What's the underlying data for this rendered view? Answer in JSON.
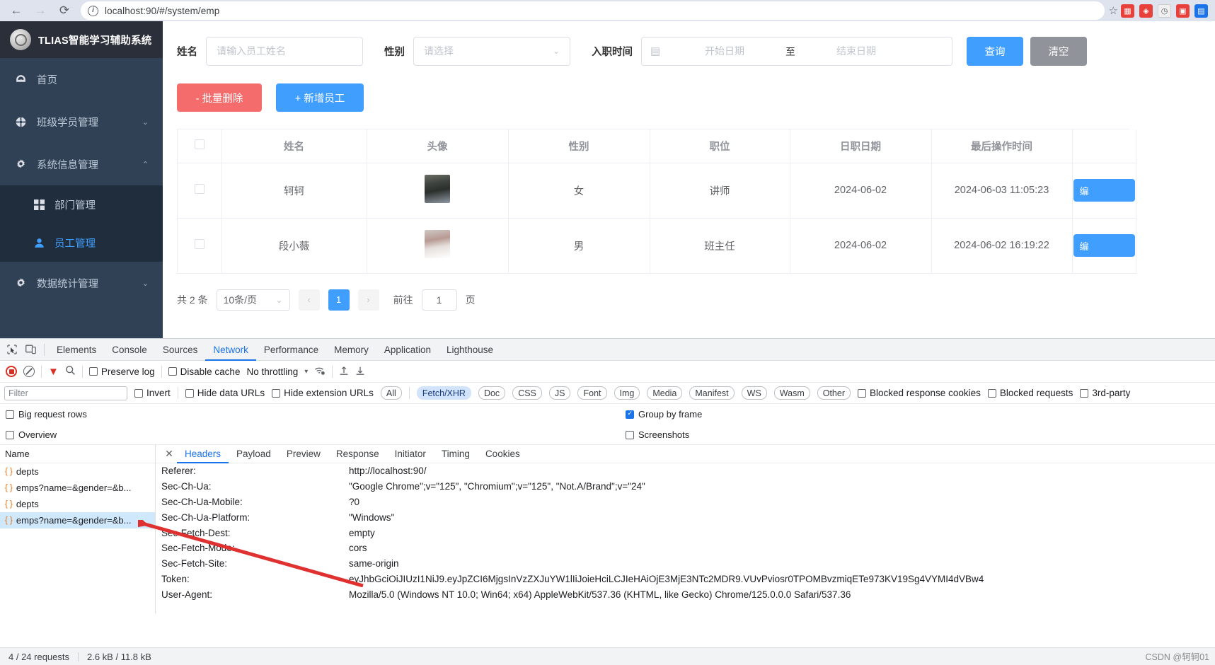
{
  "browser": {
    "back_icon": "arrow-left-icon",
    "forward_icon": "arrow-right-icon",
    "reload_icon": "reload-icon",
    "site_info_icon": "info-icon",
    "url": "localhost:90/#/system/emp",
    "bookmark_icon": "star-icon"
  },
  "sidebar": {
    "brand": "TLIAS智能学习辅助系统",
    "items": [
      {
        "label": "首页",
        "icon": "dashboard-icon",
        "arrow": ""
      },
      {
        "label": "班级学员管理",
        "icon": "share-icon",
        "arrow": "⌄"
      },
      {
        "label": "系统信息管理",
        "icon": "gear-icon",
        "arrow": "⌃"
      },
      {
        "label": "数据统计管理",
        "icon": "gear-icon",
        "arrow": "⌄"
      }
    ],
    "submenu": [
      {
        "label": "部门管理",
        "icon": "grid-icon"
      },
      {
        "label": "员工管理",
        "icon": "user-icon"
      }
    ]
  },
  "search": {
    "name_label": "姓名",
    "name_placeholder": "请输入员工姓名",
    "gender_label": "性别",
    "gender_placeholder": "请选择",
    "date_label": "入职时间",
    "date_start_placeholder": "开始日期",
    "date_separator": "至",
    "date_end_placeholder": "结束日期",
    "query_button": "查询",
    "clear_button": "清空",
    "calendar_icon": "calendar-icon",
    "chevron_icon": "chevron-down-icon"
  },
  "actions": {
    "batch_delete": "- 批量删除",
    "add_employee": "+ 新增员工"
  },
  "table": {
    "columns": [
      "",
      "姓名",
      "头像",
      "性别",
      "职位",
      "日职日期",
      "最后操作时间"
    ],
    "rows": [
      {
        "name": "轲轲",
        "avatar": "employee-photo",
        "gender": "女",
        "position": "讲师",
        "hire_date": "2024-06-02",
        "last_op": "2024-06-03 11:05:23",
        "action": "编"
      },
      {
        "name": "段小薇",
        "avatar": "employee-photo",
        "gender": "男",
        "position": "班主任",
        "hire_date": "2024-06-02",
        "last_op": "2024-06-02 16:19:22",
        "action": "编"
      }
    ]
  },
  "pagination": {
    "total": "共 2 条",
    "page_size": "10条/页",
    "prev": "‹",
    "current_page": "1",
    "next": "›",
    "goto_label": "前往",
    "goto_value": "1",
    "goto_unit": "页"
  },
  "devtools": {
    "inspect_icon": "inspect-icon",
    "device_icon": "device-toolbar-icon",
    "tabs": [
      "Elements",
      "Console",
      "Sources",
      "Network",
      "Performance",
      "Memory",
      "Application",
      "Lighthouse"
    ],
    "active_tab": "Network",
    "toolbar": {
      "record_icon": "record-icon",
      "clear_icon": "clear-icon",
      "filter_icon": "filter-icon",
      "search_icon": "search-icon",
      "preserve_log": "Preserve log",
      "disable_cache": "Disable cache",
      "throttling": "No throttling",
      "throttling_caret": "▾",
      "wifi_icon": "network-conditions-icon",
      "import_icon": "import-har-icon",
      "export_icon": "export-har-icon"
    },
    "filterbar": {
      "filter_placeholder": "Filter",
      "invert": "Invert",
      "hide_data_urls": "Hide data URLs",
      "hide_extension_urls": "Hide extension URLs",
      "types": [
        "All",
        "Fetch/XHR",
        "Doc",
        "CSS",
        "JS",
        "Font",
        "Img",
        "Media",
        "Manifest",
        "WS",
        "Wasm",
        "Other"
      ],
      "active_type": "Fetch/XHR",
      "blocked_response_cookies": "Blocked response cookies",
      "blocked_requests": "Blocked requests",
      "third_party": "3rd-party"
    },
    "options": {
      "big_request_rows": "Big request rows",
      "overview": "Overview",
      "group_by_frame": "Group by frame",
      "screenshots": "Screenshots"
    },
    "request_list": {
      "header": "Name",
      "rows": [
        {
          "name": "depts",
          "selected": false
        },
        {
          "name": "emps?name=&gender=&b...",
          "selected": false
        },
        {
          "name": "depts",
          "selected": false
        },
        {
          "name": "emps?name=&gender=&b...",
          "selected": true
        }
      ]
    },
    "detail": {
      "close_icon": "close-icon",
      "tabs": [
        "Headers",
        "Payload",
        "Preview",
        "Response",
        "Initiator",
        "Timing",
        "Cookies"
      ],
      "active_tab": "Headers",
      "headers": [
        {
          "name": "Referer:",
          "value": "http://localhost:90/"
        },
        {
          "name": "Sec-Ch-Ua:",
          "value": "\"Google Chrome\";v=\"125\", \"Chromium\";v=\"125\", \"Not.A/Brand\";v=\"24\""
        },
        {
          "name": "Sec-Ch-Ua-Mobile:",
          "value": "?0"
        },
        {
          "name": "Sec-Ch-Ua-Platform:",
          "value": "\"Windows\""
        },
        {
          "name": "Sec-Fetch-Dest:",
          "value": "empty"
        },
        {
          "name": "Sec-Fetch-Mode:",
          "value": "cors"
        },
        {
          "name": "Sec-Fetch-Site:",
          "value": "same-origin"
        },
        {
          "name": "Token:",
          "value": "eyJhbGciOiJIUzI1NiJ9.eyJpZCI6MjgsInVzZXJuYW1lIiJoieHciLCJIeHAiOjE3MjE3NTc2MDR9.VUvPviosr0TPOMBvzmiqETe973KV19Sg4VYMI4dVBw4"
        },
        {
          "name": "User-Agent:",
          "value": "Mozilla/5.0 (Windows NT 10.0; Win64; x64) AppleWebKit/537.36 (KHTML, like Gecko) Chrome/125.0.0.0 Safari/537.36"
        }
      ]
    },
    "status": {
      "requests": "4 / 24 requests",
      "transferred": "2.6 kB / 11.8 kB"
    }
  },
  "watermark": "CSDN @轲轲01",
  "colors": {
    "accent": "#409eff",
    "danger": "#f56c6c",
    "sidebar": "#304156",
    "devtools_link": "#1a73e8"
  }
}
